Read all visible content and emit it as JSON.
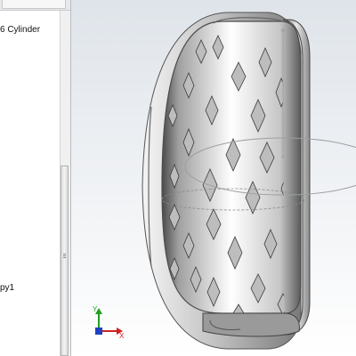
{
  "feature_tree": {
    "items": [
      {
        "label": "6 Cylinder"
      },
      {
        "label": "py1"
      }
    ]
  },
  "triad": {
    "x_label": "X",
    "y_label": "Y",
    "x_color": "#d02020",
    "y_color": "#20a020",
    "z_color": "#2040c0"
  },
  "viewport": {
    "background_top": "#dfe4ea",
    "background_bottom": "#ffffff",
    "model": "tire-cylinder-cutaway"
  }
}
